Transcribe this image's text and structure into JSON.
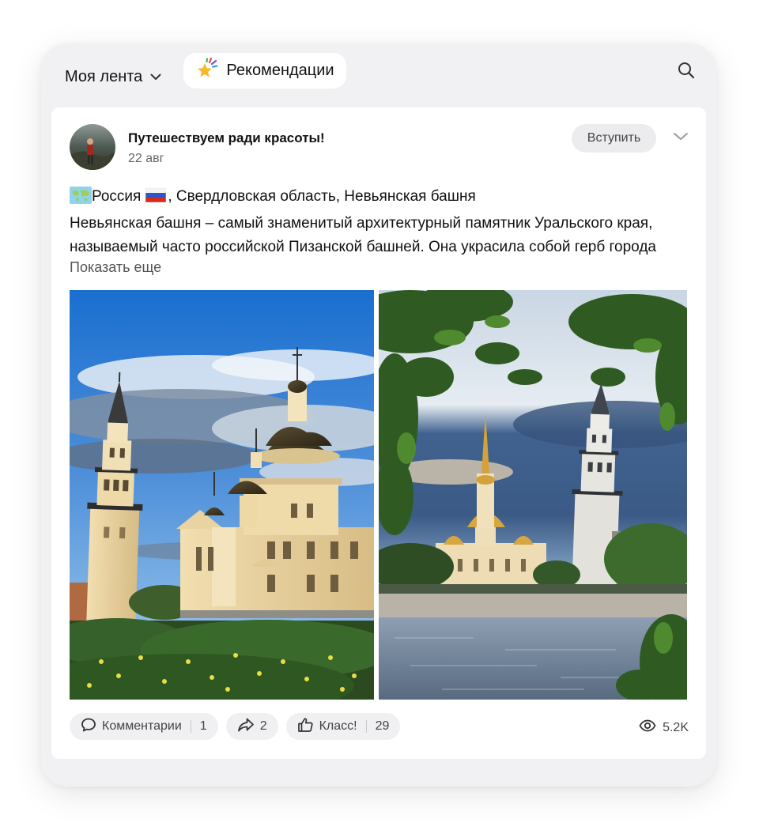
{
  "topbar": {
    "feed_label": "Моя лента",
    "feed_icon": "chevron-down-icon",
    "recommendations_label": "Рекомендации",
    "recommendations_icon": "sparkle-star-icon",
    "search_icon": "search-icon"
  },
  "post": {
    "group_name": "Путешествуем ради красоты!",
    "date": "22 авг",
    "join_label": "Вступить",
    "text_line_1": "Россия , Свердловская область, Невьянская башня",
    "text_line_1_country": "Россия",
    "text_line_1_rest": ", Свердловская область, Невьянская башня",
    "text_line_2": "Невьянская башня – самый знаменитый архитектурный памятник Уральского края,",
    "text_line_3": "называемый часто российской Пизанской башней. Она украсила собой герб города",
    "show_more": "Показать еще",
    "photos": [
      "cathedral-and-leaning-tower",
      "tower-across-pond"
    ]
  },
  "actions": {
    "comments_label": "Комментарии",
    "comments_count": "1",
    "shares_count": "2",
    "like_label": "Класс!",
    "likes_count": "29",
    "views_count": "5.2K"
  },
  "colors": {
    "frame_bg": "#f1f1f3",
    "card_bg": "#ffffff",
    "pill_bg": "#f0f0f2",
    "text_primary": "#111111",
    "text_secondary": "#666666"
  }
}
